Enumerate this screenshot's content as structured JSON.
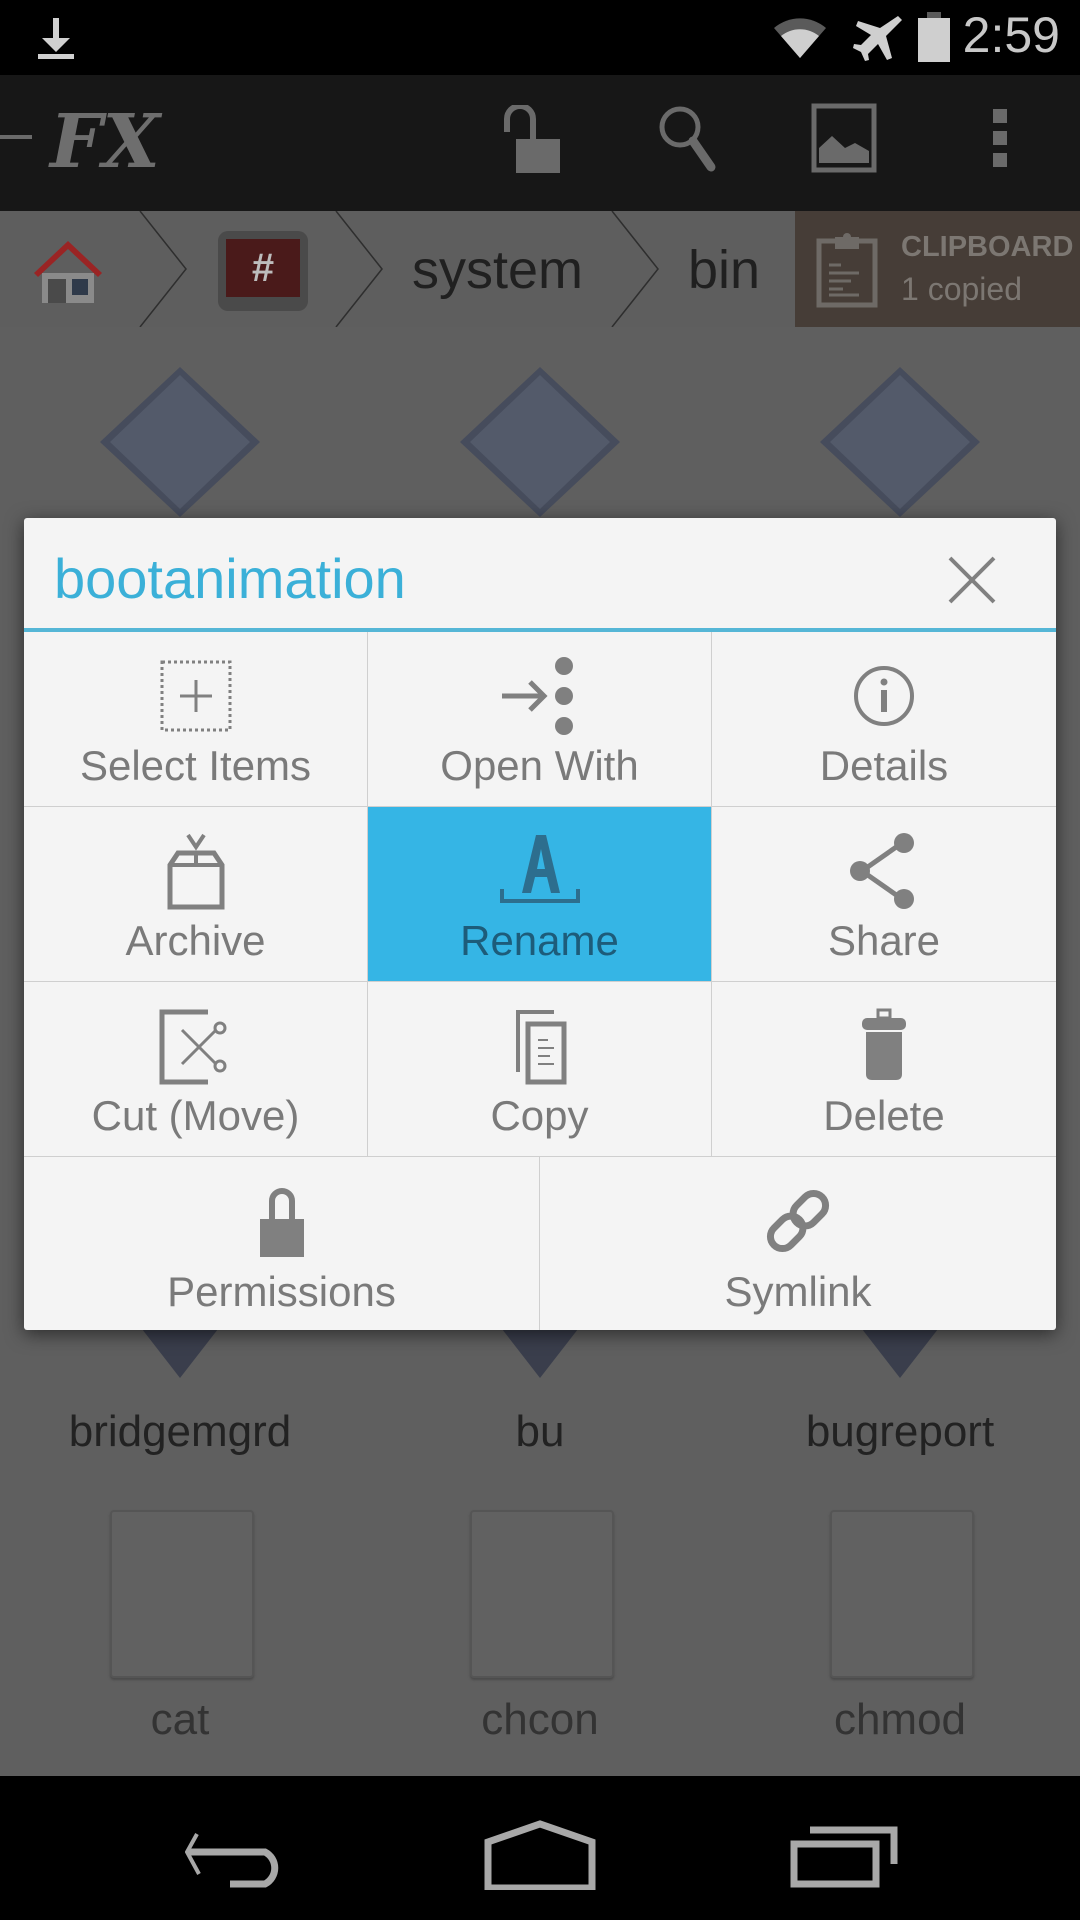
{
  "status_bar": {
    "time": "2:59",
    "icons": [
      "download-icon",
      "wifi-icon",
      "airplane-mode-icon",
      "battery-icon"
    ]
  },
  "toolbar": {
    "app_logo": "FX",
    "actions": [
      "unlock-icon",
      "search-icon",
      "image-icon",
      "overflow-menu-icon"
    ]
  },
  "breadcrumb": {
    "items": [
      {
        "type": "icon",
        "name": "home"
      },
      {
        "type": "icon",
        "name": "root",
        "glyph": "#"
      },
      {
        "type": "text",
        "label": "system"
      },
      {
        "type": "text",
        "label": "bin"
      }
    ],
    "clipboard": {
      "title": "CLIPBOARD",
      "status": "1 copied"
    }
  },
  "files": {
    "row1": [
      "",
      "",
      ""
    ],
    "row2": [
      "bridgemgrd",
      "bu",
      "bugreport"
    ],
    "row3": [
      "cat",
      "chcon",
      "chmod"
    ]
  },
  "dialog": {
    "title": "bootanimation",
    "close_label": "close",
    "accent": "#35b5e5",
    "actions": [
      {
        "label": "Select Items",
        "icon": "select-items-icon"
      },
      {
        "label": "Open With",
        "icon": "open-with-icon"
      },
      {
        "label": "Details",
        "icon": "info-icon"
      },
      {
        "label": "Archive",
        "icon": "archive-icon"
      },
      {
        "label": "Rename",
        "icon": "rename-icon",
        "selected": true
      },
      {
        "label": "Share",
        "icon": "share-icon"
      },
      {
        "label": "Cut (Move)",
        "icon": "cut-icon"
      },
      {
        "label": "Copy",
        "icon": "copy-icon"
      },
      {
        "label": "Delete",
        "icon": "trash-icon"
      },
      {
        "label": "Permissions",
        "icon": "lock-icon"
      },
      {
        "label": "Symlink",
        "icon": "link-icon"
      }
    ]
  },
  "nav_bar": {
    "buttons": [
      "back",
      "home",
      "recents"
    ]
  }
}
